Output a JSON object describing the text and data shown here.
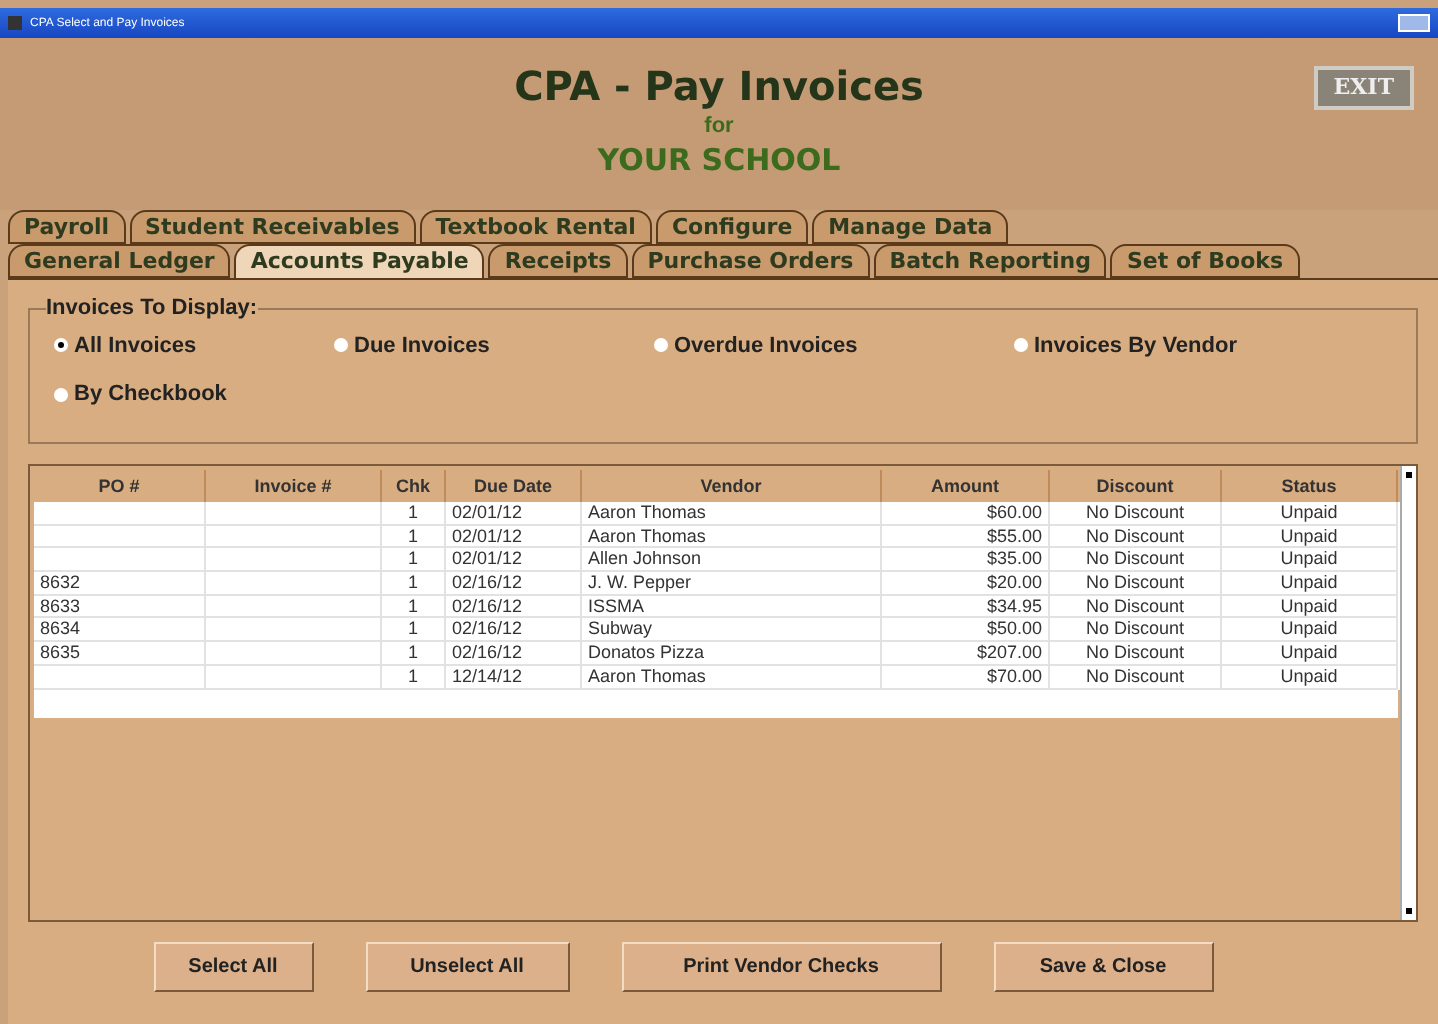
{
  "window": {
    "title": "CPA Select and Pay Invoices"
  },
  "header": {
    "title": "CPA - Pay Invoices",
    "subtitle": "for",
    "school": "YOUR SCHOOL",
    "exit": "EXIT"
  },
  "tab_rows": [
    [
      {
        "label": "Payroll",
        "selected": false
      },
      {
        "label": "Student Receivables",
        "selected": false
      },
      {
        "label": "Textbook Rental",
        "selected": false
      },
      {
        "label": "Configure",
        "selected": false
      },
      {
        "label": "Manage Data",
        "selected": false
      }
    ],
    [
      {
        "label": "General Ledger",
        "selected": false
      },
      {
        "label": "Accounts Payable",
        "selected": true
      },
      {
        "label": "Receipts",
        "selected": false
      },
      {
        "label": "Purchase Orders",
        "selected": false
      },
      {
        "label": "Batch Reporting",
        "selected": false
      },
      {
        "label": "Set of Books",
        "selected": false
      }
    ]
  ],
  "filter": {
    "legend": "Invoices To Display:",
    "options": [
      {
        "label": "All Invoices",
        "selected": true
      },
      {
        "label": "Due Invoices",
        "selected": false
      },
      {
        "label": "Overdue Invoices",
        "selected": false
      },
      {
        "label": "Invoices By Vendor",
        "selected": false
      },
      {
        "label": "By Checkbook",
        "selected": false
      }
    ]
  },
  "table": {
    "columns": [
      "PO #",
      "Invoice #",
      "Chk",
      "Due Date",
      "Vendor",
      "Amount",
      "Discount",
      "Status"
    ],
    "rows": [
      [
        "",
        "",
        "1",
        "02/01/12",
        "Aaron Thomas",
        "$60.00",
        "No Discount",
        "Unpaid"
      ],
      [
        "",
        "",
        "1",
        "02/01/12",
        "Aaron Thomas",
        "$55.00",
        "No Discount",
        "Unpaid"
      ],
      [
        "",
        "",
        "1",
        "02/01/12",
        "Allen Johnson",
        "$35.00",
        "No Discount",
        "Unpaid"
      ],
      [
        "8632",
        "",
        "1",
        "02/16/12",
        "J. W. Pepper",
        "$20.00",
        "No Discount",
        "Unpaid"
      ],
      [
        "8633",
        "",
        "1",
        "02/16/12",
        "ISSMA",
        "$34.95",
        "No Discount",
        "Unpaid"
      ],
      [
        "8634",
        "",
        "1",
        "02/16/12",
        "Subway",
        "$50.00",
        "No Discount",
        "Unpaid"
      ],
      [
        "8635",
        "",
        "1",
        "02/16/12",
        "Donatos Pizza",
        "$207.00",
        "No Discount",
        "Unpaid"
      ],
      [
        "",
        "",
        "1",
        "12/14/12",
        "Aaron Thomas",
        "$70.00",
        "No Discount",
        "Unpaid"
      ]
    ]
  },
  "buttons": [
    "Select All",
    "Unselect All",
    "Print Vendor Checks",
    "Save & Close"
  ]
}
